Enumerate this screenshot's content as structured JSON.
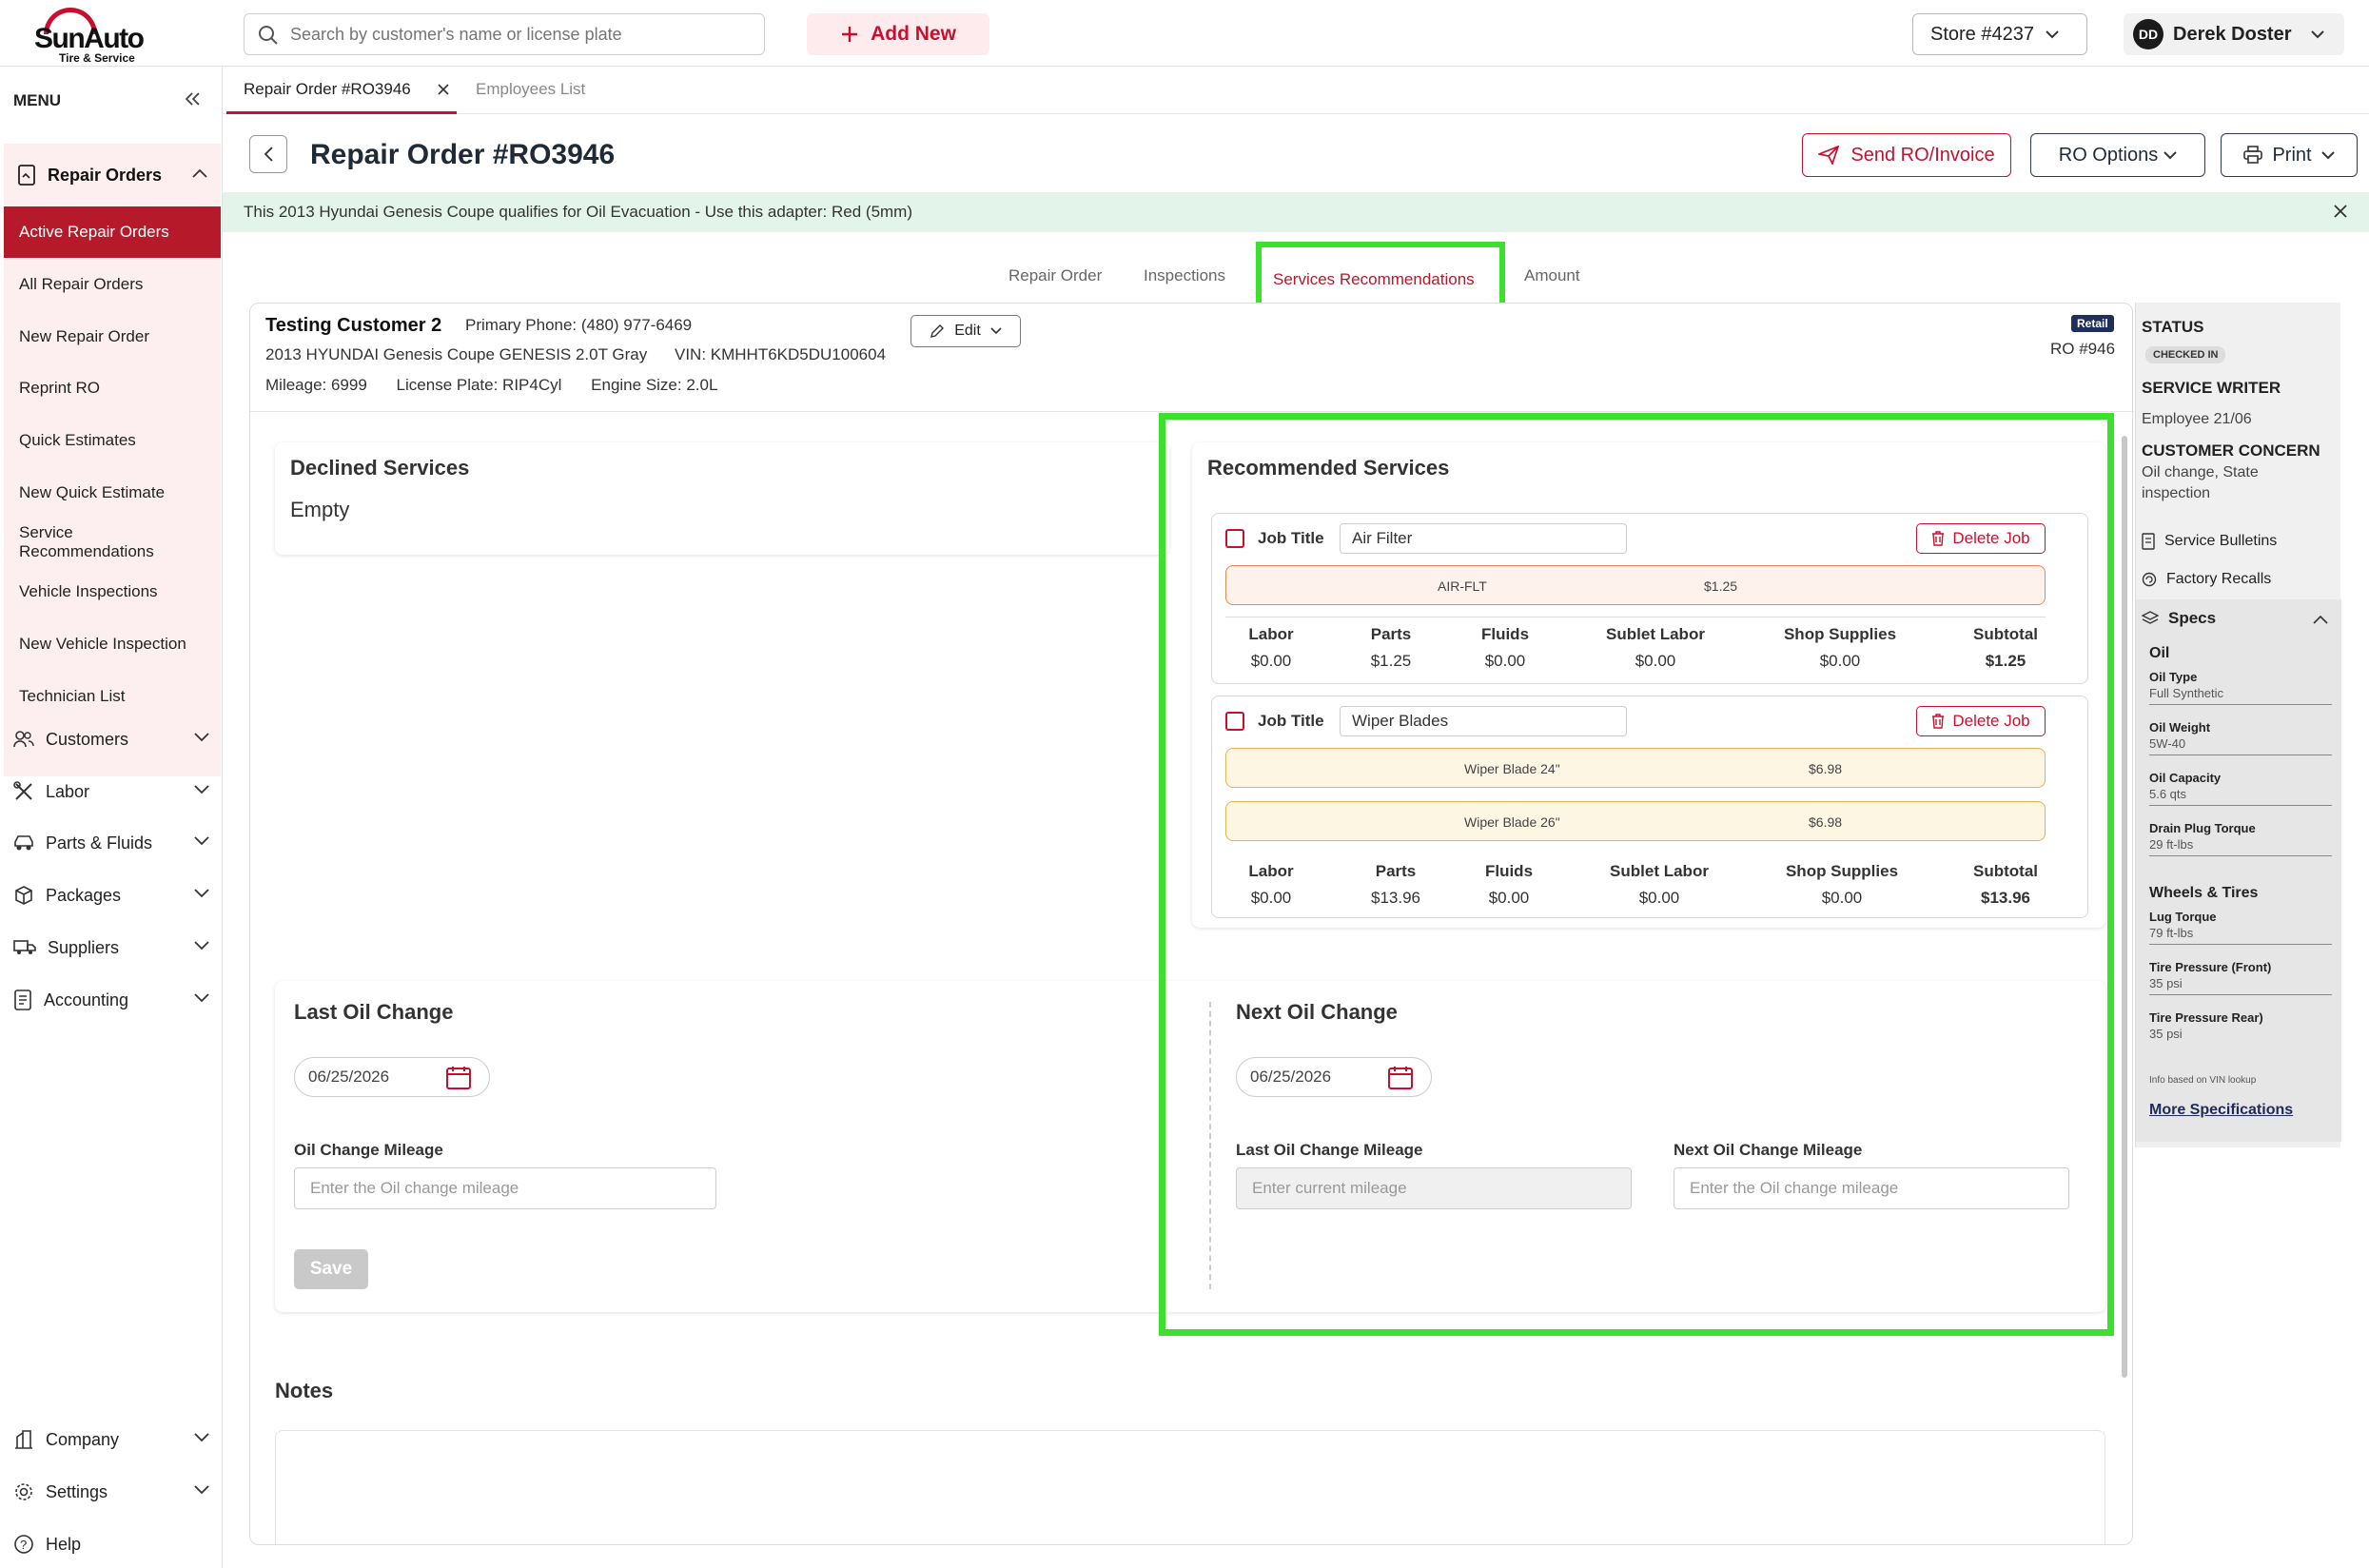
{
  "brand": {
    "name": "SunAuto",
    "tagline": "Tire & Service",
    "accent": "#c8102e"
  },
  "header": {
    "search_placeholder": "Search by customer's name or license plate",
    "add_new": "Add New",
    "store": "Store #4237",
    "user_initials": "DD",
    "user_name": "Derek Doster"
  },
  "sidebar": {
    "menu_label": "MENU",
    "repair_orders": "Repair Orders",
    "ro_items": [
      "Active Repair Orders",
      "All Repair Orders",
      "New Repair Order",
      "Reprint RO",
      "Quick Estimates",
      "New Quick Estimate",
      "Service Recommendations",
      "Vehicle Inspections",
      "New Vehicle Inspection",
      "Technician List"
    ],
    "nav": [
      "Customers",
      "Labor",
      "Parts & Fluids",
      "Packages",
      "Suppliers",
      "Accounting"
    ],
    "bottom": [
      "Company",
      "Settings",
      "Help"
    ]
  },
  "tabs": {
    "active": "Repair Order #RO3946",
    "other": "Employees List"
  },
  "page": {
    "title": "Repair Order #RO3946",
    "send": "Send RO/Invoice",
    "options": "RO Options",
    "print": "Print"
  },
  "banner": "This 2013 Hyundai Genesis Coupe qualifies for Oil Evacuation - Use this adapter: Red (5mm)",
  "subtabs": [
    "Repair Order",
    "Inspections",
    "Services Recommendations",
    "Amount"
  ],
  "customer": {
    "name": "Testing Customer 2",
    "phone": "Primary Phone: (480) 977-6469",
    "vehicle": "2013 HYUNDAI Genesis Coupe GENESIS 2.0T Gray",
    "vin": "VIN: KMHHT6KD5DU100604",
    "mileage": "Mileage: 6999",
    "plate": "License Plate: RIP4Cyl",
    "engine": "Engine Size: 2.0L",
    "edit": "Edit",
    "type": "Retail",
    "ro": "RO #946"
  },
  "declined": {
    "title": "Declined Services",
    "empty": "Empty"
  },
  "recommended": {
    "title": "Recommended Services",
    "job_title_label": "Job Title",
    "delete_label": "Delete Job",
    "total_headers": [
      "Labor",
      "Parts",
      "Fluids",
      "Sublet Labor",
      "Shop Supplies",
      "Subtotal"
    ],
    "jobs": [
      {
        "title": "Air Filter",
        "parts": [
          {
            "name": "AIR-FLT",
            "price": "$1.25"
          }
        ],
        "totals": [
          "$0.00",
          "$1.25",
          "$0.00",
          "$0.00",
          "$0.00",
          "$1.25"
        ]
      },
      {
        "title": "Wiper Blades",
        "parts": [
          {
            "name": "Wiper Blade 24\"",
            "price": "$6.98"
          },
          {
            "name": "Wiper Blade 26\"",
            "price": "$6.98"
          }
        ],
        "totals": [
          "$0.00",
          "$13.96",
          "$0.00",
          "$0.00",
          "$0.00",
          "$13.96"
        ]
      }
    ]
  },
  "last_oil": {
    "title": "Last Oil Change",
    "date": "06/25/2026",
    "mileage_label": "Oil Change Mileage",
    "mileage_placeholder": "Enter the Oil change mileage",
    "save": "Save"
  },
  "next_oil": {
    "title": "Next Oil Change",
    "date": "06/25/2026",
    "last_label": "Last Oil Change Mileage",
    "last_placeholder": "Enter current mileage",
    "next_label": "Next Oil Change Mileage",
    "next_placeholder": "Enter the Oil change mileage"
  },
  "notes": {
    "title": "Notes"
  },
  "status_panel": {
    "status_label": "STATUS",
    "status": "CHECKED IN",
    "writer_label": "SERVICE WRITER",
    "writer": "Employee 21/06",
    "concern_label": "CUSTOMER CONCERN",
    "concern": "Oil change, State inspection",
    "bulletins": "Service Bulletins",
    "recalls": "Factory Recalls",
    "specs": "Specs",
    "oil_h": "Oil",
    "oil": [
      {
        "k": "Oil Type",
        "v": "Full Synthetic"
      },
      {
        "k": "Oil Weight",
        "v": "5W-40"
      },
      {
        "k": "Oil Capacity",
        "v": "5.6 qts"
      },
      {
        "k": "Drain Plug Torque",
        "v": "29 ft-lbs"
      }
    ],
    "wheels_h": "Wheels & Tires",
    "wheels": [
      {
        "k": "Lug Torque",
        "v": "79 ft-lbs"
      },
      {
        "k": "Tire Pressure (Front)",
        "v": "35 psi"
      },
      {
        "k": "Tire Pressure Rear)",
        "v": "35 psi"
      }
    ],
    "note": "Info based on VIN lookup",
    "more": "More Specifications"
  }
}
